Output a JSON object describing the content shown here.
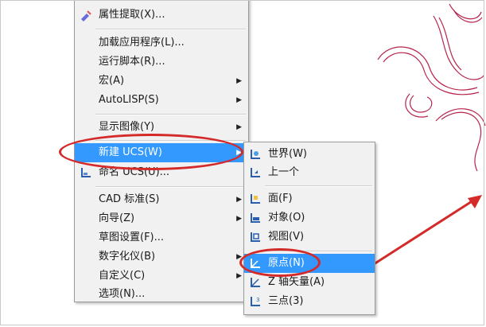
{
  "main_menu": {
    "items": [
      {
        "label": "属性提取(X)...",
        "icon": "attribute-extract-icon"
      },
      {
        "label": "加载应用程序(L)..."
      },
      {
        "label": "运行脚本(R)..."
      },
      {
        "label": "宏(A)"
      },
      {
        "label": "AutoLISP(S)"
      },
      {
        "label": "显示图像(Y)"
      },
      {
        "label": "新建 UCS(W)"
      },
      {
        "label": "命名 UCS(U)...",
        "icon": "named-ucs-icon"
      },
      {
        "label": "CAD 标准(S)"
      },
      {
        "label": "向导(Z)"
      },
      {
        "label": "草图设置(F)..."
      },
      {
        "label": "数字化仪(B)"
      },
      {
        "label": "自定义(C)"
      },
      {
        "label": "选项(N)..."
      }
    ]
  },
  "ucs_submenu": {
    "items": [
      {
        "label": "世界(W)",
        "icon": "ucs-world-icon"
      },
      {
        "label": "上一个",
        "icon": "ucs-previous-icon"
      },
      {
        "label": "面(F)",
        "icon": "ucs-face-icon"
      },
      {
        "label": "对象(O)",
        "icon": "ucs-object-icon"
      },
      {
        "label": "视图(V)",
        "icon": "ucs-view-icon"
      },
      {
        "label": "原点(N)",
        "icon": "ucs-origin-icon"
      },
      {
        "label": "Z 轴矢量(A)",
        "icon": "ucs-z-axis-icon"
      },
      {
        "label": "三点(3)",
        "icon": "ucs-3point-icon"
      }
    ]
  },
  "colors": {
    "highlight": "#3399ff",
    "annotation": "#d42a2a",
    "drawing_line": "#b8234a"
  }
}
